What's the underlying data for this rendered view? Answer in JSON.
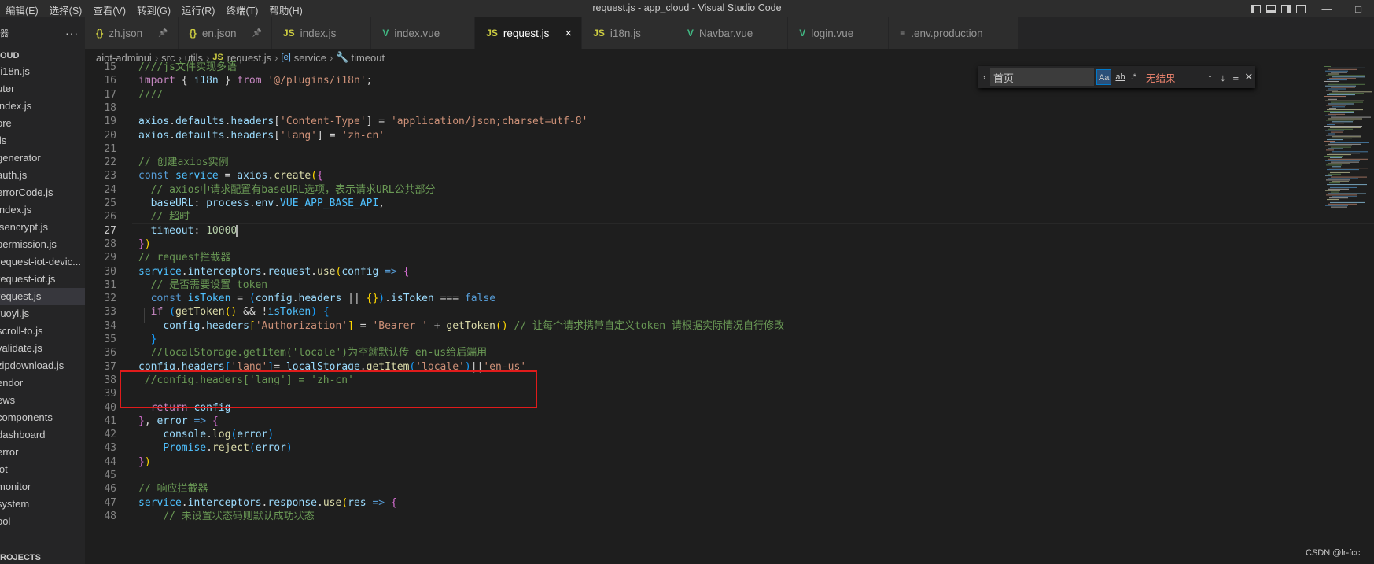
{
  "window": {
    "title": "request.js - app_cloud - Visual Studio Code"
  },
  "menu": [
    "编辑(E)",
    "选择(S)",
    "查看(V)",
    "转到(G)",
    "运行(R)",
    "终端(T)",
    "帮助(H)"
  ],
  "sidebar": {
    "header": "器",
    "root": "OUD",
    "items": [
      {
        "label": "-i18n.js",
        "active": false
      },
      {
        "label": "uter",
        "active": false
      },
      {
        "label": "index.js",
        "active": false
      },
      {
        "label": "ore",
        "active": false
      },
      {
        "label": "ils",
        "active": false
      },
      {
        "label": "generator",
        "active": false
      },
      {
        "label": "auth.js",
        "active": false
      },
      {
        "label": "errorCode.js",
        "active": false
      },
      {
        "label": "index.js",
        "active": false
      },
      {
        "label": "jsencrypt.js",
        "active": false
      },
      {
        "label": "permission.js",
        "active": false
      },
      {
        "label": "request-iot-devic...",
        "active": false
      },
      {
        "label": "request-iot.js",
        "active": false
      },
      {
        "label": "request.js",
        "active": true
      },
      {
        "label": "ruoyi.js",
        "active": false
      },
      {
        "label": "scroll-to.js",
        "active": false
      },
      {
        "label": "validate.js",
        "active": false
      },
      {
        "label": "zipdownload.js",
        "active": false
      },
      {
        "label": "endor",
        "active": false
      },
      {
        "label": "ews",
        "active": false
      },
      {
        "label": "components",
        "active": false
      },
      {
        "label": "dashboard",
        "active": false
      },
      {
        "label": "error",
        "active": false
      },
      {
        "label": "iot",
        "active": false
      },
      {
        "label": "monitor",
        "active": false
      },
      {
        "label": "system",
        "active": false
      },
      {
        "label": "ool",
        "active": false
      }
    ],
    "footer": "ROJECTS"
  },
  "tabs": [
    {
      "label": "zh.json",
      "icon": "{}",
      "icon_color": "#cbcb41",
      "pinned": true,
      "active": false
    },
    {
      "label": "en.json",
      "icon": "{}",
      "icon_color": "#cbcb41",
      "pinned": true,
      "active": false
    },
    {
      "label": "index.js",
      "icon": "JS",
      "icon_color": "#cbcb41",
      "active": false
    },
    {
      "label": "index.vue",
      "icon": "V",
      "icon_color": "#41b883",
      "active": false
    },
    {
      "label": "request.js",
      "icon": "JS",
      "icon_color": "#cbcb41",
      "active": true
    },
    {
      "label": "i18n.js",
      "icon": "JS",
      "icon_color": "#cbcb41",
      "active": false
    },
    {
      "label": "Navbar.vue",
      "icon": "V",
      "icon_color": "#41b883",
      "active": false
    },
    {
      "label": "login.vue",
      "icon": "V",
      "icon_color": "#41b883",
      "active": false
    },
    {
      "label": ".env.production",
      "icon": "≡",
      "icon_color": "#a0a0a0",
      "active": false
    }
  ],
  "breadcrumb": {
    "project": "aiot-adminui",
    "folder1": "src",
    "folder2": "utils",
    "file": "request.js",
    "symbol1": "service",
    "symbol2": "timeout"
  },
  "find": {
    "value": "首页",
    "case_label": "Aa",
    "word_label": "ab",
    "regex_label": ".*",
    "no_results": "无结果"
  },
  "editor": {
    "current_line": 27,
    "lines": [
      {
        "n": 15,
        "tokens": [
          [
            "cm",
            "////js文件实现多语"
          ]
        ]
      },
      {
        "n": 16,
        "tokens": [
          [
            "ctl",
            "import"
          ],
          [
            "pl",
            " { "
          ],
          [
            "var",
            "i18n"
          ],
          [
            "pl",
            " } "
          ],
          [
            "ctl",
            "from"
          ],
          [
            "pl",
            " "
          ],
          [
            "str",
            "'@/plugins/i18n'"
          ],
          [
            "pl",
            ";"
          ]
        ]
      },
      {
        "n": 17,
        "tokens": [
          [
            "cm",
            "////"
          ]
        ]
      },
      {
        "n": 18,
        "tokens": []
      },
      {
        "n": 19,
        "tokens": [
          [
            "var",
            "axios"
          ],
          [
            "pl",
            "."
          ],
          [
            "var",
            "defaults"
          ],
          [
            "pl",
            "."
          ],
          [
            "var",
            "headers"
          ],
          [
            "pl",
            "["
          ],
          [
            "str",
            "'Content-Type'"
          ],
          [
            "pl",
            "] = "
          ],
          [
            "str",
            "'application/json;charset=utf-8'"
          ]
        ]
      },
      {
        "n": 20,
        "tokens": [
          [
            "var",
            "axios"
          ],
          [
            "pl",
            "."
          ],
          [
            "var",
            "defaults"
          ],
          [
            "pl",
            "."
          ],
          [
            "var",
            "headers"
          ],
          [
            "pl",
            "["
          ],
          [
            "str",
            "'lang'"
          ],
          [
            "pl",
            "] = "
          ],
          [
            "str",
            "'zh-cn'"
          ]
        ]
      },
      {
        "n": 21,
        "tokens": []
      },
      {
        "n": 22,
        "tokens": [
          [
            "cm",
            "// 创建axios实例"
          ]
        ]
      },
      {
        "n": 23,
        "tokens": [
          [
            "kw",
            "const"
          ],
          [
            "pl",
            " "
          ],
          [
            "cst",
            "service"
          ],
          [
            "pl",
            " = "
          ],
          [
            "var",
            "axios"
          ],
          [
            "pl",
            "."
          ],
          [
            "fn",
            "create"
          ],
          [
            "br",
            "("
          ],
          [
            "br2",
            "{"
          ]
        ]
      },
      {
        "n": 24,
        "tokens": [
          [
            "pl",
            "  "
          ],
          [
            "cm",
            "// axios中请求配置有baseURL选项，表示请求URL公共部分"
          ]
        ]
      },
      {
        "n": 25,
        "tokens": [
          [
            "pl",
            "  "
          ],
          [
            "var",
            "baseURL"
          ],
          [
            "pl",
            ": "
          ],
          [
            "var",
            "process"
          ],
          [
            "pl",
            "."
          ],
          [
            "var",
            "env"
          ],
          [
            "pl",
            "."
          ],
          [
            "cst",
            "VUE_APP_BASE_API"
          ],
          [
            "pl",
            ","
          ]
        ]
      },
      {
        "n": 26,
        "tokens": [
          [
            "pl",
            "  "
          ],
          [
            "cm",
            "// 超时"
          ]
        ]
      },
      {
        "n": 27,
        "tokens": [
          [
            "pl",
            "  "
          ],
          [
            "var",
            "timeout"
          ],
          [
            "pl",
            ": "
          ],
          [
            "num",
            "10000"
          ]
        ]
      },
      {
        "n": 28,
        "tokens": [
          [
            "br2",
            "}"
          ],
          [
            "br",
            ")"
          ]
        ]
      },
      {
        "n": 29,
        "tokens": [
          [
            "cm",
            "// request拦截器"
          ]
        ]
      },
      {
        "n": 30,
        "tokens": [
          [
            "cst",
            "service"
          ],
          [
            "pl",
            "."
          ],
          [
            "var",
            "interceptors"
          ],
          [
            "pl",
            "."
          ],
          [
            "var",
            "request"
          ],
          [
            "pl",
            "."
          ],
          [
            "fn",
            "use"
          ],
          [
            "br",
            "("
          ],
          [
            "var",
            "config"
          ],
          [
            "pl",
            " "
          ],
          [
            "kw",
            "=>"
          ],
          [
            "pl",
            " "
          ],
          [
            "br2",
            "{"
          ]
        ]
      },
      {
        "n": 31,
        "tokens": [
          [
            "pl",
            "  "
          ],
          [
            "cm",
            "// 是否需要设置 token"
          ]
        ]
      },
      {
        "n": 32,
        "tokens": [
          [
            "pl",
            "  "
          ],
          [
            "kw",
            "const"
          ],
          [
            "pl",
            " "
          ],
          [
            "cst",
            "isToken"
          ],
          [
            "pl",
            " = "
          ],
          [
            "br3",
            "("
          ],
          [
            "var",
            "config"
          ],
          [
            "pl",
            "."
          ],
          [
            "var",
            "headers"
          ],
          [
            "pl",
            " || "
          ],
          [
            "br",
            "{}"
          ],
          [
            "br3",
            ")"
          ],
          [
            "pl",
            "."
          ],
          [
            "var",
            "isToken"
          ],
          [
            "pl",
            " === "
          ],
          [
            "kw",
            "false"
          ]
        ]
      },
      {
        "n": 33,
        "tokens": [
          [
            "pl",
            "  "
          ],
          [
            "ctl",
            "if"
          ],
          [
            "pl",
            " "
          ],
          [
            "br3",
            "("
          ],
          [
            "fn",
            "getToken"
          ],
          [
            "br",
            "()"
          ],
          [
            "pl",
            " && !"
          ],
          [
            "cst",
            "isToken"
          ],
          [
            "br3",
            ")"
          ],
          [
            "pl",
            " "
          ],
          [
            "br3",
            "{"
          ]
        ]
      },
      {
        "n": 34,
        "tokens": [
          [
            "pl",
            "    "
          ],
          [
            "var",
            "config"
          ],
          [
            "pl",
            "."
          ],
          [
            "var",
            "headers"
          ],
          [
            "br",
            "["
          ],
          [
            "str",
            "'Authorization'"
          ],
          [
            "br",
            "]"
          ],
          [
            "pl",
            " = "
          ],
          [
            "str",
            "'Bearer '"
          ],
          [
            "pl",
            " + "
          ],
          [
            "fn",
            "getToken"
          ],
          [
            "br",
            "()"
          ],
          [
            "pl",
            " "
          ],
          [
            "cm",
            "// 让每个请求携带自定义token 请根据实际情况自行修改"
          ]
        ]
      },
      {
        "n": 35,
        "tokens": [
          [
            "pl",
            "  "
          ],
          [
            "br3",
            "}"
          ]
        ]
      },
      {
        "n": 36,
        "tokens": [
          [
            "pl",
            "  "
          ],
          [
            "cm",
            "//localStorage.getItem('locale')为空就默认传 en-us给后端用"
          ]
        ]
      },
      {
        "n": 37,
        "tokens": [
          [
            "var",
            "config"
          ],
          [
            "pl",
            "."
          ],
          [
            "var",
            "headers"
          ],
          [
            "br3",
            "["
          ],
          [
            "str",
            "'lang'"
          ],
          [
            "br3",
            "]"
          ],
          [
            "pl",
            "= "
          ],
          [
            "var",
            "localStorage"
          ],
          [
            "pl",
            "."
          ],
          [
            "fn",
            "getItem"
          ],
          [
            "br3",
            "("
          ],
          [
            "str",
            "'locale'"
          ],
          [
            "br3",
            ")"
          ],
          [
            "pl",
            "||"
          ],
          [
            "str",
            "'en-us'"
          ]
        ]
      },
      {
        "n": 38,
        "tokens": [
          [
            "pl",
            " "
          ],
          [
            "cm",
            "//config.headers['lang'] = 'zh-cn'"
          ]
        ]
      },
      {
        "n": 39,
        "tokens": []
      },
      {
        "n": 40,
        "tokens": [
          [
            "pl",
            "  "
          ],
          [
            "ctl",
            "return"
          ],
          [
            "pl",
            " "
          ],
          [
            "var",
            "config"
          ]
        ]
      },
      {
        "n": 41,
        "tokens": [
          [
            "br2",
            "}"
          ],
          [
            "pl",
            ", "
          ],
          [
            "var",
            "error"
          ],
          [
            "pl",
            " "
          ],
          [
            "kw",
            "=>"
          ],
          [
            "pl",
            " "
          ],
          [
            "br2",
            "{"
          ]
        ]
      },
      {
        "n": 42,
        "tokens": [
          [
            "pl",
            "    "
          ],
          [
            "var",
            "console"
          ],
          [
            "pl",
            "."
          ],
          [
            "fn",
            "log"
          ],
          [
            "br3",
            "("
          ],
          [
            "var",
            "error"
          ],
          [
            "br3",
            ")"
          ]
        ]
      },
      {
        "n": 43,
        "tokens": [
          [
            "pl",
            "    "
          ],
          [
            "cst",
            "Promise"
          ],
          [
            "pl",
            "."
          ],
          [
            "fn",
            "reject"
          ],
          [
            "br3",
            "("
          ],
          [
            "var",
            "error"
          ],
          [
            "br3",
            ")"
          ]
        ]
      },
      {
        "n": 44,
        "tokens": [
          [
            "br2",
            "}"
          ],
          [
            "br",
            ")"
          ]
        ]
      },
      {
        "n": 45,
        "tokens": []
      },
      {
        "n": 46,
        "tokens": [
          [
            "cm",
            "// 响应拦截器"
          ]
        ]
      },
      {
        "n": 47,
        "tokens": [
          [
            "cst",
            "service"
          ],
          [
            "pl",
            "."
          ],
          [
            "var",
            "interceptors"
          ],
          [
            "pl",
            "."
          ],
          [
            "var",
            "response"
          ],
          [
            "pl",
            "."
          ],
          [
            "fn",
            "use"
          ],
          [
            "br",
            "("
          ],
          [
            "var",
            "res"
          ],
          [
            "pl",
            " "
          ],
          [
            "kw",
            "=>"
          ],
          [
            "pl",
            " "
          ],
          [
            "br2",
            "{"
          ]
        ]
      },
      {
        "n": 48,
        "tokens": [
          [
            "pl",
            "    "
          ],
          [
            "cm",
            "// 未设置状态码则默认成功状态"
          ]
        ]
      }
    ]
  },
  "watermark": "CSDN @lr-fcc"
}
